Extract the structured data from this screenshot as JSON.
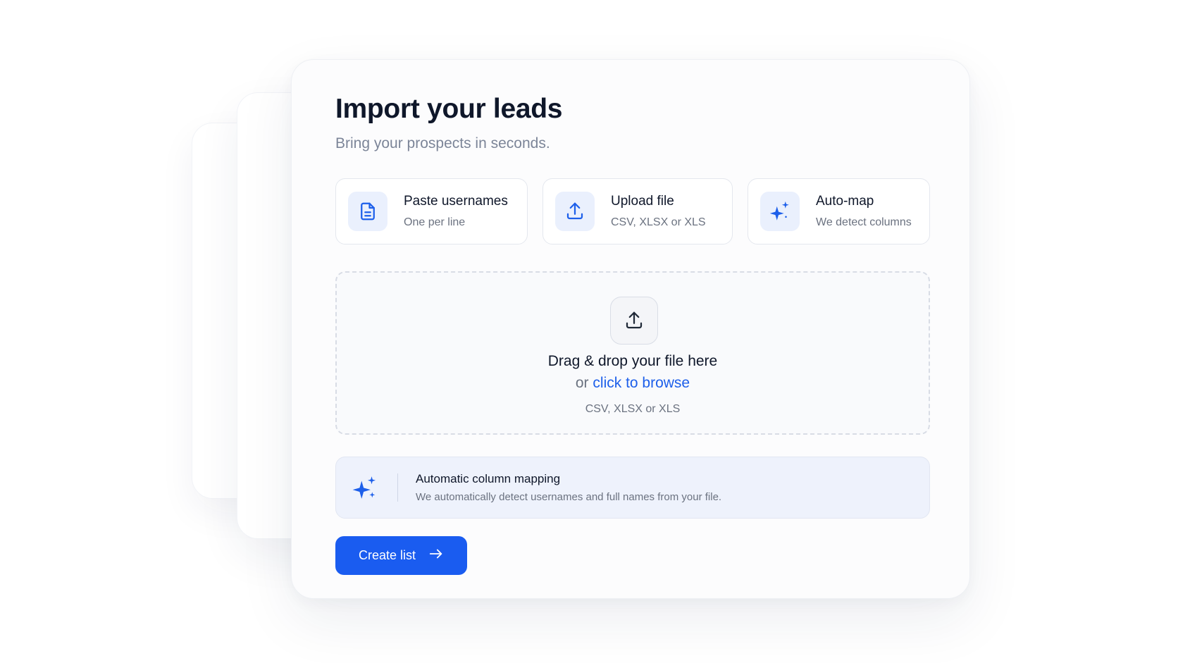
{
  "header": {
    "title": "Import your leads",
    "subtitle": "Bring your prospects in seconds."
  },
  "options": [
    {
      "title": "Paste usernames",
      "subtitle": "One per line",
      "icon": "document-icon"
    },
    {
      "title": "Upload file",
      "subtitle": "CSV, XLSX or XLS",
      "icon": "upload-icon"
    },
    {
      "title": "Auto-map",
      "subtitle": "We detect columns",
      "icon": "sparkle-icon"
    }
  ],
  "dropzone": {
    "title": "Drag & drop your file here",
    "browse_prefix": "or",
    "browse_link": "click to browse",
    "formats": "CSV, XLSX or XLS",
    "icon": "upload-icon"
  },
  "mapping": {
    "title": "Automatic column mapping",
    "description": "We automatically detect usernames and full names from your file.",
    "icon": "sparkle-icon"
  },
  "actions": {
    "create_label": "Create list",
    "create_icon": "arrow-right-icon"
  },
  "colors": {
    "accent": "#1a5cf0",
    "link": "#1d5fea",
    "icon_bg": "#eaf0fd",
    "mapping_bg": "#eef2fc"
  }
}
